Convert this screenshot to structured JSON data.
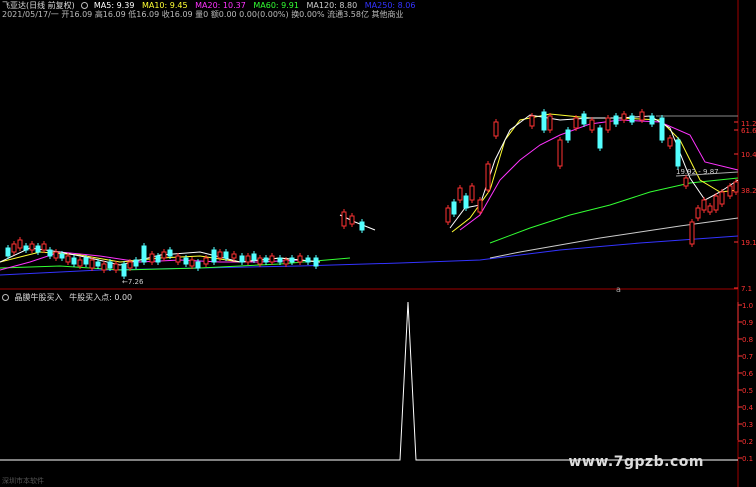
{
  "header": {
    "title": "飞亚达(日线 前复权)",
    "ma": [
      {
        "label": "MA5: 9.39",
        "color": "#ffffff"
      },
      {
        "label": "MA10: 9.45",
        "color": "#ffff33"
      },
      {
        "label": "MA20: 10.37",
        "color": "#ff33ff"
      },
      {
        "label": "MA60: 9.91",
        "color": "#33ff33"
      },
      {
        "label": "MA120: 8.80",
        "color": "#cccccc"
      },
      {
        "label": "MA250: 8.06",
        "color": "#3333ff"
      }
    ]
  },
  "quote": {
    "date": "2021/05/17/一",
    "open": "开16.09",
    "high": "高16.09",
    "low": "低16.09",
    "close": "收16.09",
    "volume": "量0",
    "amount": "额0.00",
    "change": "0.00(0.00%)",
    "turnover": "换0.00%",
    "float": "流通3.58亿",
    "sector": "其他商业"
  },
  "price_axis": {
    "labels": [
      "11.2",
      "61.6",
      "10.4",
      "38.2",
      "19.1",
      "7.1"
    ],
    "annotations": {
      "low_marker": "←7.26",
      "range_marker": "19.92 - 9.87"
    },
    "color": "#ff3333"
  },
  "indicator": {
    "title": "晶膜牛股买入",
    "value_text": "牛股买入点: 0.00",
    "axis_labels": [
      "1.0",
      "0.9",
      "0.8",
      "0.7",
      "0.6",
      "0.5",
      "0.4",
      "0.3",
      "0.2",
      "0.1"
    ]
  },
  "button_a": "a",
  "watermark": "www.7gpzb.com",
  "footer": "深圳市本软件",
  "colors": {
    "up": "#ff3232",
    "down": "#54ffff",
    "grid": "#800000"
  }
}
